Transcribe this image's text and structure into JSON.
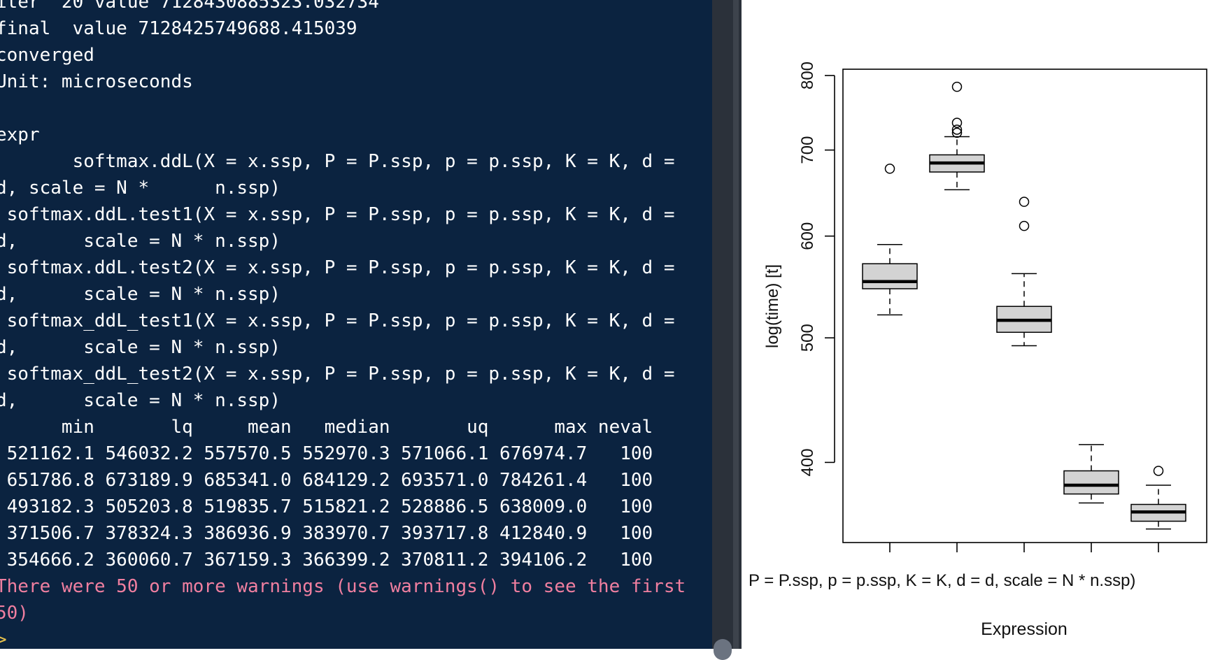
{
  "console": {
    "lines": [
      {
        "text": "iter  20 value 7128430885323.032734",
        "kind": "out"
      },
      {
        "text": "final  value 7128425749688.415039",
        "kind": "out"
      },
      {
        "text": "converged",
        "kind": "out"
      },
      {
        "text": "Unit: microseconds",
        "kind": "out"
      },
      {
        "text": "",
        "kind": "out"
      },
      {
        "text": "expr",
        "kind": "out"
      },
      {
        "text": "       softmax.ddL(X = x.ssp, P = P.ssp, p = p.ssp, K = K, d =",
        "kind": "out"
      },
      {
        "text": "d, scale = N *      n.ssp)",
        "kind": "out"
      },
      {
        "text": " softmax.ddL.test1(X = x.ssp, P = P.ssp, p = p.ssp, K = K, d =",
        "kind": "out"
      },
      {
        "text": "d,      scale = N * n.ssp)",
        "kind": "out"
      },
      {
        "text": " softmax.ddL.test2(X = x.ssp, P = P.ssp, p = p.ssp, K = K, d =",
        "kind": "out"
      },
      {
        "text": "d,      scale = N * n.ssp)",
        "kind": "out"
      },
      {
        "text": " softmax_ddL_test1(X = x.ssp, P = P.ssp, p = p.ssp, K = K, d =",
        "kind": "out"
      },
      {
        "text": "d,      scale = N * n.ssp)",
        "kind": "out"
      },
      {
        "text": " softmax_ddL_test2(X = x.ssp, P = P.ssp, p = p.ssp, K = K, d =",
        "kind": "out"
      },
      {
        "text": "d,      scale = N * n.ssp)",
        "kind": "out"
      },
      {
        "text": "      min       lq     mean   median       uq      max neval",
        "kind": "out"
      },
      {
        "text": " 521162.1 546032.2 557570.5 552970.3 571066.1 676974.7   100",
        "kind": "out"
      },
      {
        "text": " 651786.8 673189.9 685341.0 684129.2 693571.0 784261.4   100",
        "kind": "out"
      },
      {
        "text": " 493182.3 505203.8 519835.7 515821.2 528886.5 638009.0   100",
        "kind": "out"
      },
      {
        "text": " 371506.7 378324.3 386936.9 383970.7 393717.8 412840.9   100",
        "kind": "out"
      },
      {
        "text": " 354666.2 360060.7 367159.3 366399.2 370811.2 394106.2   100",
        "kind": "out"
      },
      {
        "text": "There were 50 or more warnings (use warnings() to see the first",
        "kind": "warn"
      },
      {
        "text": "50)",
        "kind": "warn"
      },
      {
        "text": ">",
        "kind": "prompt"
      }
    ]
  },
  "plot": {
    "ylabel": "log(time) [t]",
    "xlabel": "Expression",
    "x_tick_label": "P = P.ssp, p = p.ssp, K = K, d = d, scale = N *      n.ssp)",
    "y_ticks": [
      400,
      500,
      600,
      700,
      800
    ],
    "y_tick_labels": [
      "400",
      "500",
      "600",
      "700",
      "800"
    ]
  },
  "chart_data": {
    "type": "box",
    "log_scale_y": true,
    "ylim": [
      350,
      800
    ],
    "ylabel": "log(time) [t]",
    "xlabel": "Expression",
    "boxes": [
      {
        "whisker_low": 521,
        "q1": 546,
        "median": 553,
        "q3": 571,
        "whisker_high": 591,
        "outliers": [
          677
        ]
      },
      {
        "whisker_low": 652,
        "q1": 673,
        "median": 684,
        "q3": 694,
        "whisker_high": 717,
        "outliers": [
          722,
          726,
          735,
          784
        ]
      },
      {
        "whisker_low": 493,
        "q1": 505,
        "median": 516,
        "q3": 529,
        "whisker_high": 561,
        "outliers": [
          611,
          638
        ]
      },
      {
        "whisker_low": 372,
        "q1": 378,
        "median": 384,
        "q3": 394,
        "whisker_high": 413,
        "outliers": []
      },
      {
        "whisker_low": 355,
        "q1": 360,
        "median": 366,
        "q3": 371,
        "whisker_high": 384,
        "outliers": [
          394
        ]
      }
    ],
    "box_fill": "#d3d3d3"
  },
  "colors": {
    "console_bg": "#0b2340",
    "console_text": "#ffffff",
    "warning_text": "#f07fa0",
    "prompt": "#e6c04c"
  }
}
